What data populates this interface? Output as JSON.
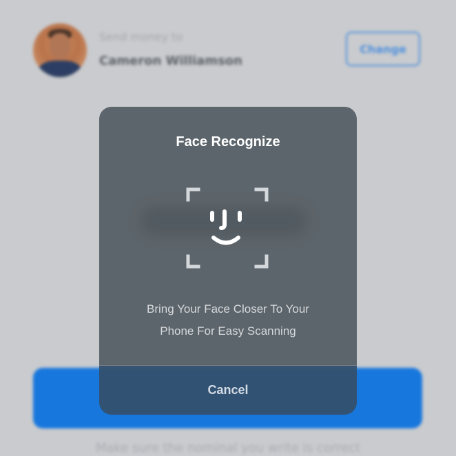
{
  "recipient": {
    "send_label": "Send money to",
    "name": "Cameron Williamson",
    "change_label": "Change"
  },
  "footer": {
    "hint": "Make sure the nominal you write is correct"
  },
  "modal": {
    "title": "Face Recognize",
    "description_line1": "Bring Your Face Closer To Your",
    "description_line2": "Phone For Easy Scanning",
    "cancel_label": "Cancel",
    "icon": "face-id-icon"
  },
  "colors": {
    "accent": "#1877dd",
    "modal_bg": "#545c63",
    "screen_bg": "#c9cbce"
  }
}
